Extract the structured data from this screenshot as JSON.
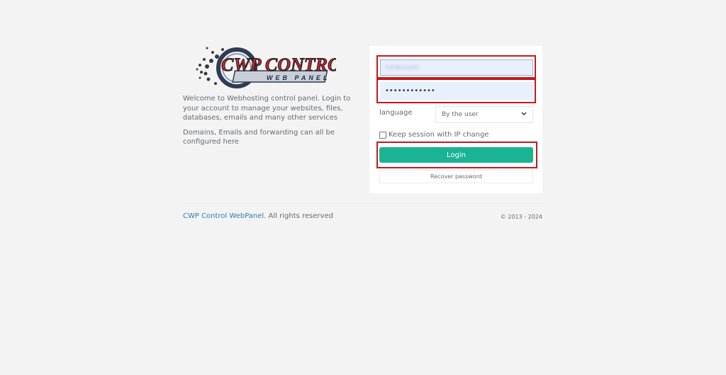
{
  "logo": {
    "text_top": "CWP CONTROL",
    "text_bottom": "WEB PANEL"
  },
  "intro": {
    "paragraph1": "Welcome to Webhosting control panel. Login to your account to manage your websites, files, databases, emails and many other services",
    "paragraph2": "Domains, Emails and forwarding can all be configured here"
  },
  "form": {
    "username_value": "newuser",
    "password_value": "••••••••••••",
    "language_label": "language",
    "language_selected": "By the user",
    "keep_session_label": "Keep session with IP change",
    "keep_session_checked": false,
    "login_label": "Login",
    "recover_label": "Recover password"
  },
  "footer": {
    "brand_link": "CWP Control WebPanel",
    "rights": ". All rights reserved",
    "copyright": "© 2013 - 2024"
  },
  "colors": {
    "background": "#f3f3f4",
    "login_button": "#1ab394",
    "highlight_border": "#c6171d",
    "input_autofill": "#e8f0fe",
    "link": "#337ab7"
  }
}
